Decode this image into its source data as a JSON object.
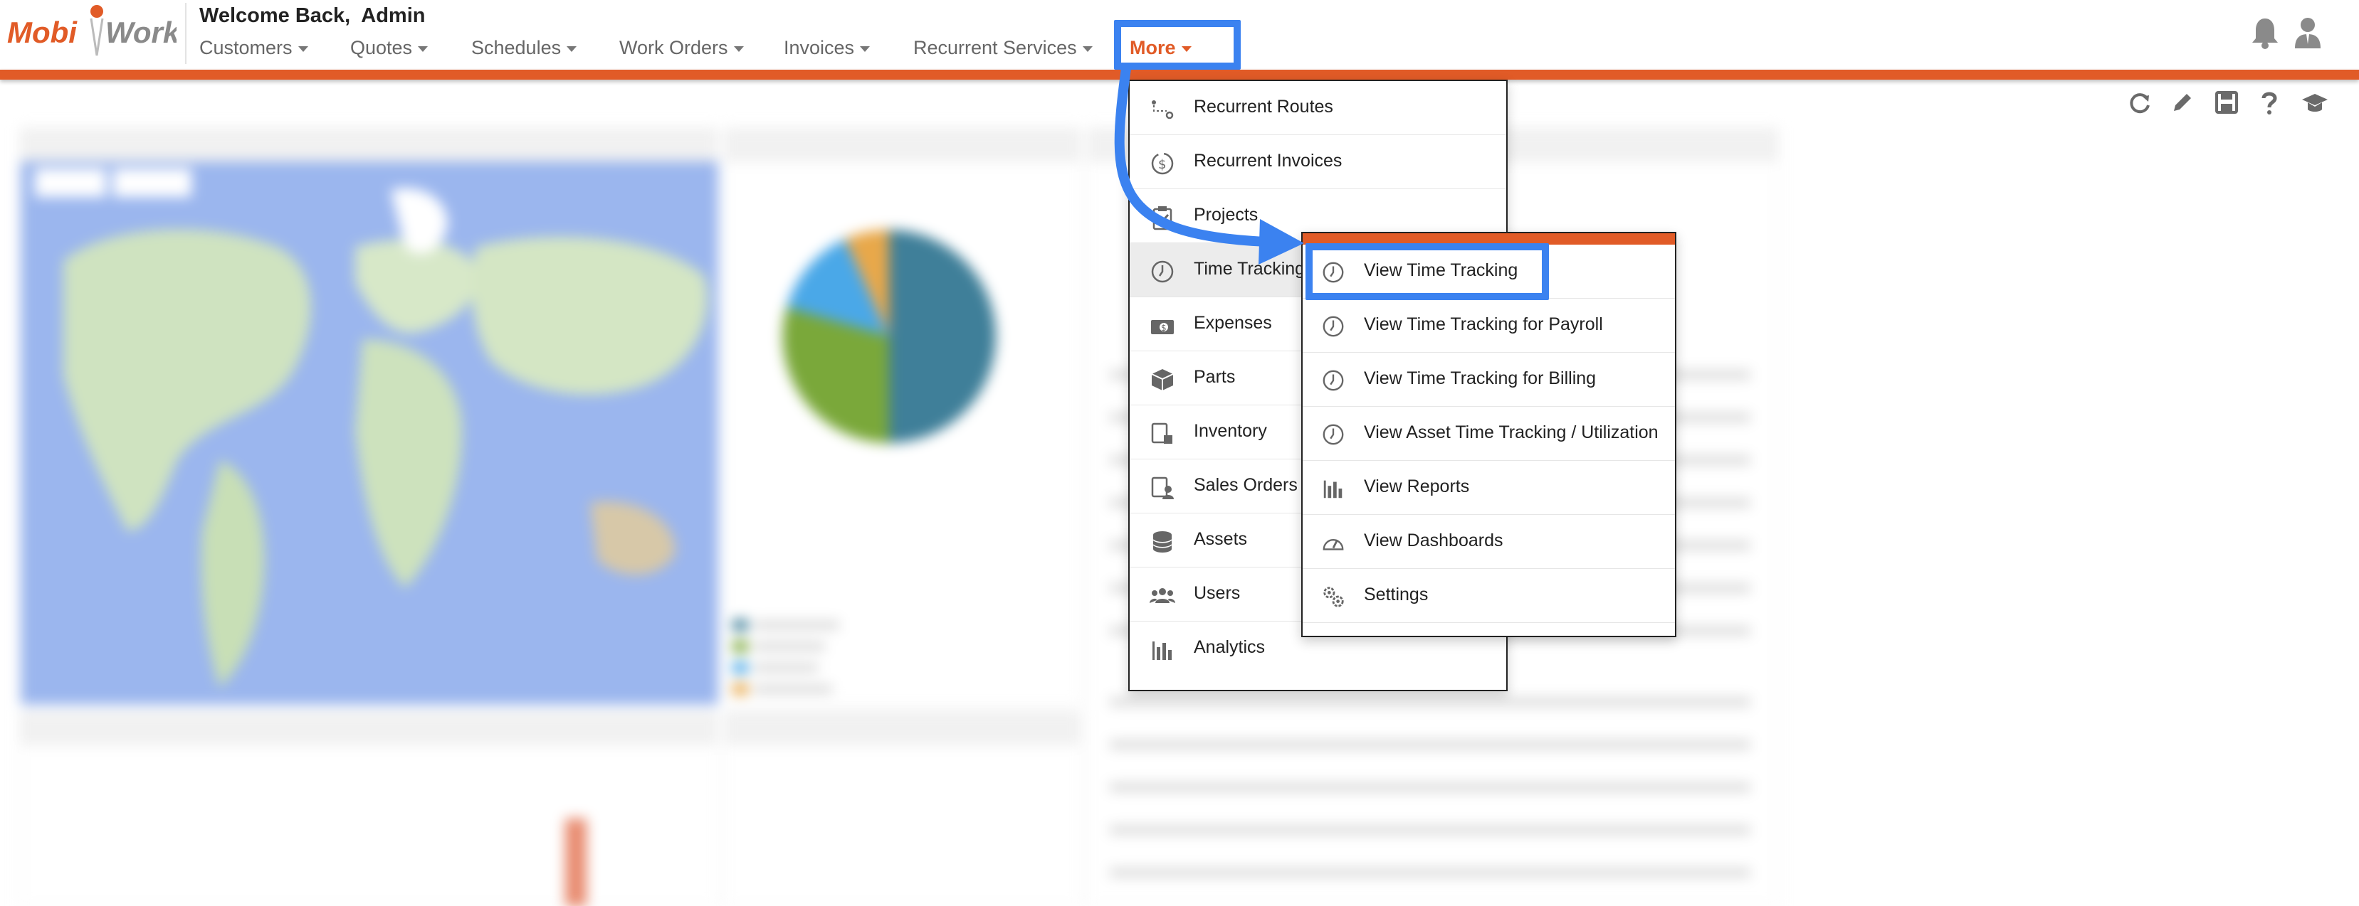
{
  "header": {
    "logo_left": "Mobi",
    "logo_right": "Work",
    "welcome": "Welcome Back,  Admin",
    "nav": [
      {
        "label": "Customers"
      },
      {
        "label": "Quotes"
      },
      {
        "label": "Schedules"
      },
      {
        "label": "Work Orders"
      },
      {
        "label": "Invoices"
      },
      {
        "label": "Recurrent Services"
      },
      {
        "label": "More"
      }
    ],
    "icons": [
      "bell-icon",
      "user-icon"
    ]
  },
  "toolbar": {
    "icons": [
      "refresh-icon",
      "pencil-icon",
      "save-icon",
      "help-icon",
      "graduation-cap-icon"
    ]
  },
  "more_menu": {
    "items": [
      {
        "label": "Recurrent Routes",
        "icon": "route-icon"
      },
      {
        "label": "Recurrent Invoices",
        "icon": "dollar-cycle-icon"
      },
      {
        "label": "Projects",
        "icon": "clipboard-check-icon"
      },
      {
        "label": "Time Tracking",
        "icon": "clock-icon"
      },
      {
        "label": "Expenses",
        "icon": "money-icon"
      },
      {
        "label": "Parts",
        "icon": "box-icon"
      },
      {
        "label": "Inventory",
        "icon": "inventory-icon"
      },
      {
        "label": "Sales Orders",
        "icon": "sales-orders-icon"
      },
      {
        "label": "Assets",
        "icon": "database-icon"
      },
      {
        "label": "Users",
        "icon": "users-icon"
      },
      {
        "label": "Analytics",
        "icon": "bar-chart-icon"
      }
    ]
  },
  "time_tracking_submenu": {
    "items": [
      {
        "label": "View Time Tracking",
        "icon": "clock-icon"
      },
      {
        "label": "View Time Tracking for Payroll",
        "icon": "clock-icon"
      },
      {
        "label": "View Time Tracking for Billing",
        "icon": "clock-icon"
      },
      {
        "label": "View Asset Time Tracking / Utilization",
        "icon": "clock-icon"
      },
      {
        "label": "View Reports",
        "icon": "bar-chart-icon"
      },
      {
        "label": "View Dashboards",
        "icon": "gauge-icon"
      },
      {
        "label": "Settings",
        "icon": "gears-icon"
      }
    ]
  },
  "colors": {
    "brand": "#e15b27",
    "highlight": "#3b82f0",
    "pie": [
      "#3f7f99",
      "#7aa83a",
      "#4aa8e8",
      "#e8a84a"
    ]
  }
}
